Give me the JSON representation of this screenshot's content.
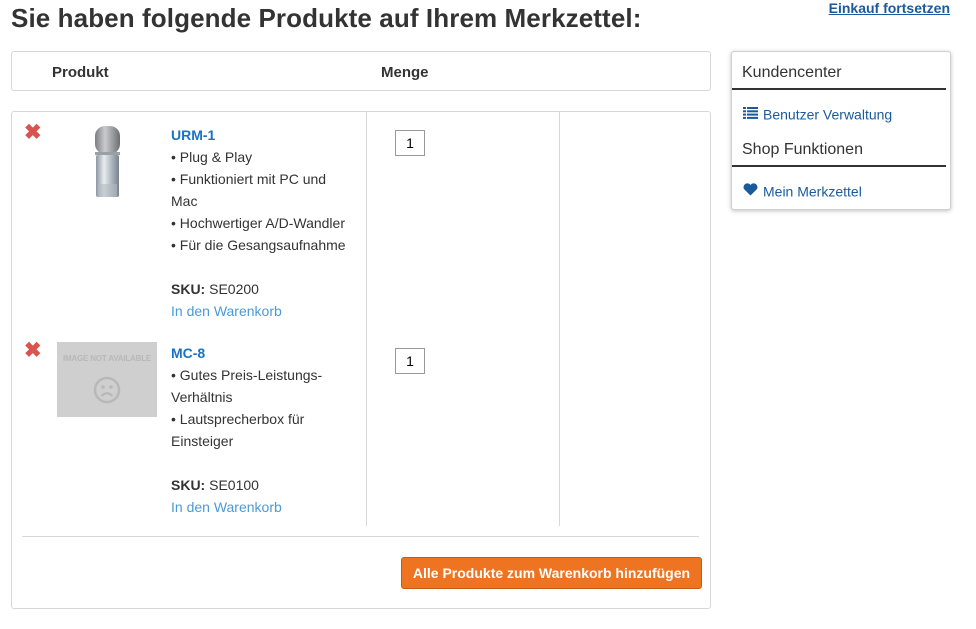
{
  "page": {
    "title": "Sie haben folgende Produkte auf Ihrem Merkzettel:",
    "continue_link": "Einkauf fortsetzen"
  },
  "table": {
    "col_product": "Produkt",
    "col_quantity": "Menge"
  },
  "items": [
    {
      "name": "URM-1",
      "features": [
        "• Plug & Play",
        "• Funktioniert mit PC und Mac",
        "• Hochwertiger A/D-Wandler",
        "• Für die Gesangsaufnahme"
      ],
      "sku_label": "SKU:",
      "sku": "SE0200",
      "cart_link": "In den Warenkorb",
      "quantity": "1",
      "image": "microphone"
    },
    {
      "name": "MC-8",
      "features": [
        "• Gutes Preis-Leistungs-Verhältnis",
        "• Lautsprecherbox für Einsteiger"
      ],
      "sku_label": "SKU:",
      "sku": "SE0100",
      "cart_link": "In den Warenkorb",
      "quantity": "1",
      "image": "image-not-available",
      "image_text": "IMAGE NOT AVAILABLE"
    }
  ],
  "actions": {
    "add_all": "Alle Produkte zum Warenkorb hinzufügen"
  },
  "sidebar": {
    "heading_customer": "Kundencenter",
    "link_user_admin": "Benutzer Verwaltung",
    "heading_shop": "Shop Funktionen",
    "link_wishlist": "Mein Merkzettel"
  },
  "colors": {
    "link": "#1a72c4",
    "button": "#ee7421",
    "remove": "#d9534f"
  }
}
